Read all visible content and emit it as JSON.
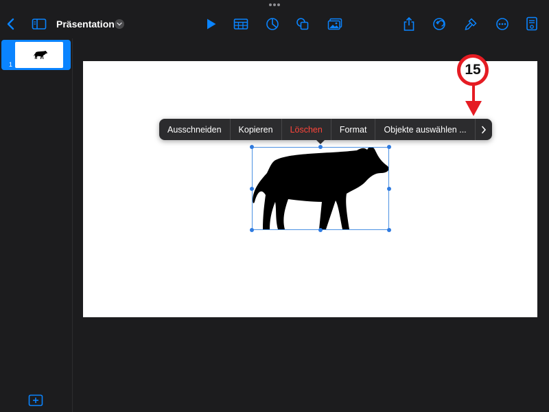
{
  "toolbar": {
    "back_icon": "chevron-left-icon",
    "sidebar_icon": "sidebar-icon",
    "title": "Präsentation",
    "title_menu_icon": "chevron-down-icon",
    "center_icons": [
      "play-icon",
      "table-icon",
      "chart-icon",
      "shapes-icon",
      "media-icon"
    ],
    "right_icons": [
      "share-icon",
      "undo-icon",
      "format-brush-icon",
      "more-icon",
      "presenter-icon"
    ]
  },
  "slide_navigator": {
    "slides": [
      {
        "number": "1",
        "selected": true
      }
    ],
    "add_slide_icon": "plus-icon"
  },
  "context_menu": {
    "items": [
      {
        "label": "Ausschneiden"
      },
      {
        "label": "Kopieren"
      },
      {
        "label": "Löschen",
        "destructive": true
      },
      {
        "label": "Format"
      },
      {
        "label": "Objekte auswählen ..."
      }
    ],
    "more_icon": "chevron-right-icon"
  },
  "annotation": {
    "step_number": "15",
    "color": "#e51c23"
  },
  "colors": {
    "accent": "#0a84ff",
    "background": "#1c1c1e",
    "destructive": "#ff453a",
    "selection": "#2f7be0"
  }
}
